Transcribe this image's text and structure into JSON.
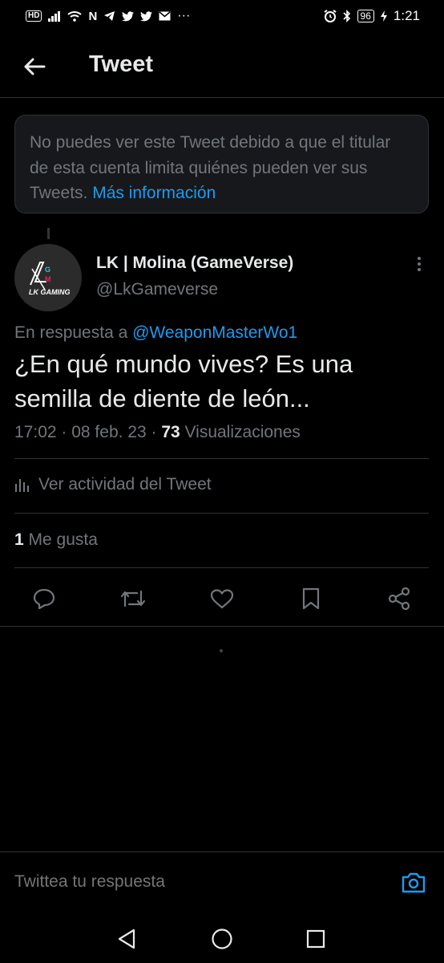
{
  "status_bar": {
    "hd": "HD",
    "carrier_icon": "N",
    "battery": "96",
    "time": "1:21",
    "dots": "···"
  },
  "header": {
    "title": "Tweet",
    "back_icon": "arrow-left-icon"
  },
  "notice": {
    "text": "No puedes ver este Tweet debido a que el titular de esta cuenta limita quiénes pueden ver sus Tweets. ",
    "link": "Más información"
  },
  "tweet": {
    "display_name": "LK | Molina (GameVerse)",
    "handle": "@LkGameverse",
    "avatar_text": "LK GAMING",
    "reply_prefix": "En respuesta a ",
    "reply_to": "@WeaponMasterWo1",
    "text": "¿En qué mundo vives? Es una semilla de diente de león...",
    "time": "17:02",
    "date": "08 feb. 23",
    "views_count": "73",
    "views_label": "Visualizaciones",
    "activity_label": "Ver actividad del Tweet",
    "likes_count": "1",
    "likes_label": "Me gusta"
  },
  "actions": [
    "reply-icon",
    "retweet-icon",
    "like-icon",
    "bookmark-icon",
    "share-icon"
  ],
  "reply_bar": {
    "placeholder": "Twittea tu respuesta"
  },
  "colors": {
    "background": "#000000",
    "accent": "#1d9bf0",
    "secondary_text": "#71767b",
    "primary_text": "#e7e9ea"
  }
}
